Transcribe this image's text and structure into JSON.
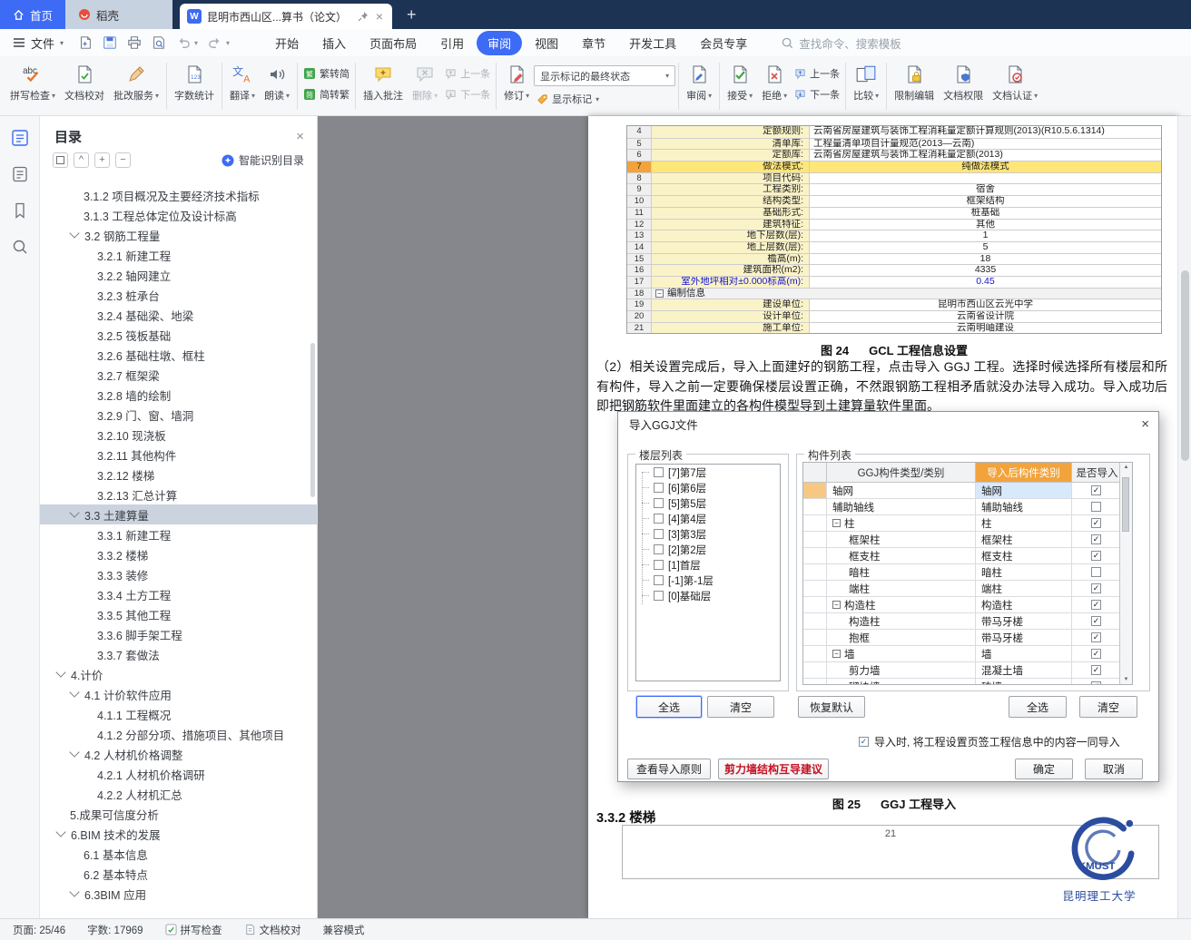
{
  "icons": {
    "caret": "▾",
    "close": "×",
    "plus": "+",
    "minus": "−",
    "check": "✓",
    "collapse": "^",
    "tri_up": "▲",
    "tri_down": "▼",
    "w": "W",
    "abc": "abc",
    "nums": "123",
    "wen": "文",
    "a": "A",
    "jian": "简",
    "fan": "繁"
  },
  "tabs": {
    "home": "首页",
    "docer": "稻壳",
    "document": "昆明市西山区...算书（论文）"
  },
  "menu": {
    "file": "文件",
    "items": [
      "开始",
      "插入",
      "页面布局",
      "引用",
      "审阅",
      "视图",
      "章节",
      "开发工具",
      "会员专享"
    ],
    "search_placeholder": "查找命令、搜索模板"
  },
  "ribbon": {
    "spellcheck": "拼写检查",
    "proofread": "文档校对",
    "correction": "批改服务",
    "wordcount": "字数统计",
    "translate": "翻译",
    "readaloud": "朗读",
    "t2s": "繁转简",
    "s2t": "简转繁",
    "insert_comment": "插入批注",
    "delete": "删除",
    "prev": "上一条",
    "next": "下一条",
    "track": "修订",
    "markup_state": "显示标记的最终状态",
    "show_markup": "显示标记",
    "review": "审阅",
    "accept": "接受",
    "reject": "拒绝",
    "prev2": "上一条",
    "next2": "下一条",
    "compare": "比较",
    "restrict": "限制编辑",
    "perms": "文档权限",
    "certify": "文档认证"
  },
  "nav": {
    "title": "目录",
    "smart_label": "智能识别目录",
    "items": [
      {
        "label": "3.1.2 项目概况及主要经济技术指标",
        "level": 2,
        "chevron": false
      },
      {
        "label": "3.1.3 工程总体定位及设计标高",
        "level": 2,
        "chevron": false
      },
      {
        "label": "3.2 钢筋工程量",
        "level": 2,
        "chevron": true
      },
      {
        "label": "3.2.1 新建工程",
        "level": 3,
        "chevron": false
      },
      {
        "label": "3.2.2 轴网建立",
        "level": 3,
        "chevron": false
      },
      {
        "label": "3.2.3 桩承台",
        "level": 3,
        "chevron": false
      },
      {
        "label": "3.2.4 基础梁、地梁",
        "level": 3,
        "chevron": false
      },
      {
        "label": "3.2.5 筏板基础",
        "level": 3,
        "chevron": false
      },
      {
        "label": "3.2.6 基础柱墩、框柱",
        "level": 3,
        "chevron": false
      },
      {
        "label": "3.2.7 框架梁",
        "level": 3,
        "chevron": false
      },
      {
        "label": "3.2.8 墙的绘制",
        "level": 3,
        "chevron": false
      },
      {
        "label": "3.2.9 门、窗、墙洞",
        "level": 3,
        "chevron": false
      },
      {
        "label": "3.2.10 现浇板",
        "level": 3,
        "chevron": false
      },
      {
        "label": "3.2.11 其他构件",
        "level": 3,
        "chevron": false
      },
      {
        "label": "3.2.12 楼梯",
        "level": 3,
        "chevron": false
      },
      {
        "label": "3.2.13 汇总计算",
        "level": 3,
        "chevron": false
      },
      {
        "label": "3.3 土建算量",
        "level": 2,
        "chevron": true,
        "selected": true
      },
      {
        "label": "3.3.1 新建工程",
        "level": 3,
        "chevron": false
      },
      {
        "label": "3.3.2 楼梯",
        "level": 3,
        "chevron": false
      },
      {
        "label": "3.3.3 装修",
        "level": 3,
        "chevron": false
      },
      {
        "label": "3.3.4 土方工程",
        "level": 3,
        "chevron": false
      },
      {
        "label": "3.3.5 其他工程",
        "level": 3,
        "chevron": false
      },
      {
        "label": "3.3.6 脚手架工程",
        "level": 3,
        "chevron": false
      },
      {
        "label": "3.3.7 套做法",
        "level": 3,
        "chevron": false
      },
      {
        "label": "4.计价",
        "level": 1,
        "chevron": true
      },
      {
        "label": "4.1 计价软件应用",
        "level": 2,
        "chevron": true
      },
      {
        "label": "4.1.1 工程概况",
        "level": 3,
        "chevron": false
      },
      {
        "label": "4.1.2 分部分项、措施项目、其他项目",
        "level": 3,
        "chevron": false
      },
      {
        "label": "4.2 人材机价格调整",
        "level": 2,
        "chevron": true
      },
      {
        "label": "4.2.1 人材机价格调研",
        "level": 3,
        "chevron": false
      },
      {
        "label": "4.2.2 人材机汇总",
        "level": 3,
        "chevron": false
      },
      {
        "label": "5.成果可信度分析",
        "level": 1,
        "chevron": false
      },
      {
        "label": "6.BIM 技术的发展",
        "level": 1,
        "chevron": true
      },
      {
        "label": "6.1 基本信息",
        "level": 2,
        "chevron": false
      },
      {
        "label": "6.2 基本特点",
        "level": 2,
        "chevron": false
      },
      {
        "label": "6.3BIM 应用",
        "level": 2,
        "chevron": true
      }
    ]
  },
  "gcl_table": {
    "caption_fig": "图 24",
    "caption_text": "GCL 工程信息设置",
    "rows": [
      {
        "num": "4",
        "label": "定额规则:",
        "value": "云南省房屋建筑与装饰工程消耗量定额计算规则(2013)(R10.5.6.1314)",
        "long": true
      },
      {
        "num": "5",
        "label": "清单库:",
        "value": "工程量清单项目计量规范(2013—云南)",
        "long": true
      },
      {
        "num": "6",
        "label": "定额库:",
        "value": "云南省房屋建筑与装饰工程消耗量定额(2013)",
        "long": true
      },
      {
        "num": "7",
        "label": "做法模式:",
        "value": "纯做法模式",
        "highlight": true
      },
      {
        "num": "8",
        "label": "项目代码:",
        "value": ""
      },
      {
        "num": "9",
        "label": "工程类别:",
        "value": "宿舍"
      },
      {
        "num": "10",
        "label": "结构类型:",
        "value": "框架结构"
      },
      {
        "num": "11",
        "label": "基础形式:",
        "value": "桩基础"
      },
      {
        "num": "12",
        "label": "建筑特征:",
        "value": "其他"
      },
      {
        "num": "13",
        "label": "地下层数(层):",
        "value": "1"
      },
      {
        "num": "14",
        "label": "地上层数(层):",
        "value": "5"
      },
      {
        "num": "15",
        "label": "檐高(m):",
        "value": "18"
      },
      {
        "num": "16",
        "label": "建筑面积(m2):",
        "value": "4335"
      },
      {
        "num": "17",
        "label": "室外地坪相对±0.000标高(m):",
        "value": "0.45",
        "blue": true
      },
      {
        "num": "18",
        "label": "编制信息",
        "group": true
      },
      {
        "num": "19",
        "label": "建设单位:",
        "value": "昆明市西山区云光中学"
      },
      {
        "num": "20",
        "label": "设计单位:",
        "value": "云南省设计院"
      },
      {
        "num": "21",
        "label": "施工单位:",
        "value": "云南明岫建设"
      }
    ]
  },
  "paragraph": "（2）相关设置完成后，导入上面建好的钢筋工程，点击导入 GGJ 工程。选择时候选择所有楼层和所有构件，导入之前一定要确保楼层设置正确，不然跟钢筋工程相矛盾就没办法导入成功。导入成功后即把钢筋软件里面建立的各构件模型导到土建算量软件里面。",
  "dialog": {
    "title": "导入GGJ文件",
    "floors_label": "楼层列表",
    "floors": [
      "[7]第7层",
      "[6]第6层",
      "[5]第5层",
      "[4]第4层",
      "[3]第3层",
      "[2]第2层",
      "[1]首层",
      "[-1]第-1层",
      "[0]基础层"
    ],
    "select_all": "全选",
    "clear": "清空",
    "components_label": "构件列表",
    "col_type": "GGJ构件类型/类别",
    "col_after": "导入后构件类别",
    "col_import": "是否导入",
    "rows": [
      {
        "type": "轴网",
        "after": "轴网",
        "checked": true,
        "current": true
      },
      {
        "type": "辅助轴线",
        "after": "辅助轴线",
        "checked": false
      },
      {
        "type": "柱",
        "after": "柱",
        "checked": true,
        "group": true
      },
      {
        "type": "框架柱",
        "after": "框架柱",
        "checked": true,
        "child": true
      },
      {
        "type": "框支柱",
        "after": "框支柱",
        "checked": true,
        "child": true
      },
      {
        "type": "暗柱",
        "after": "暗柱",
        "checked": false,
        "child": true
      },
      {
        "type": "端柱",
        "after": "端柱",
        "checked": true,
        "child": true
      },
      {
        "type": "构造柱",
        "after": "构造柱",
        "checked": true,
        "group": true
      },
      {
        "type": "构造柱",
        "after": "带马牙槎",
        "checked": true,
        "child": true
      },
      {
        "type": "抱框",
        "after": "带马牙槎",
        "checked": true,
        "child": true
      },
      {
        "type": "墙",
        "after": "墙",
        "checked": true,
        "group": true
      },
      {
        "type": "剪力墙",
        "after": "混凝土墙",
        "checked": true,
        "child": true
      },
      {
        "type": "砌块墙",
        "after": "砖墙",
        "checked": true,
        "child": true
      }
    ],
    "restore_default": "恢复默认",
    "import_note": "导入时, 将工程设置页签工程信息中的内容一同导入",
    "view_rules": "查看导入原则",
    "shear_advice": "剪力墙结构互导建议",
    "ok": "确定",
    "cancel": "取消",
    "caption_fig": "图 25",
    "caption_text": "GGJ 工程导入"
  },
  "heading": "3.3.2 楼梯",
  "page_number": "21",
  "logo": {
    "text": "KMUST",
    "caption": "昆明理工大学"
  },
  "statusbar": {
    "page": "页面: 25/46",
    "words": "字数: 17969",
    "spell": "拼写检查",
    "proof": "文档校对",
    "mode": "兼容模式"
  }
}
